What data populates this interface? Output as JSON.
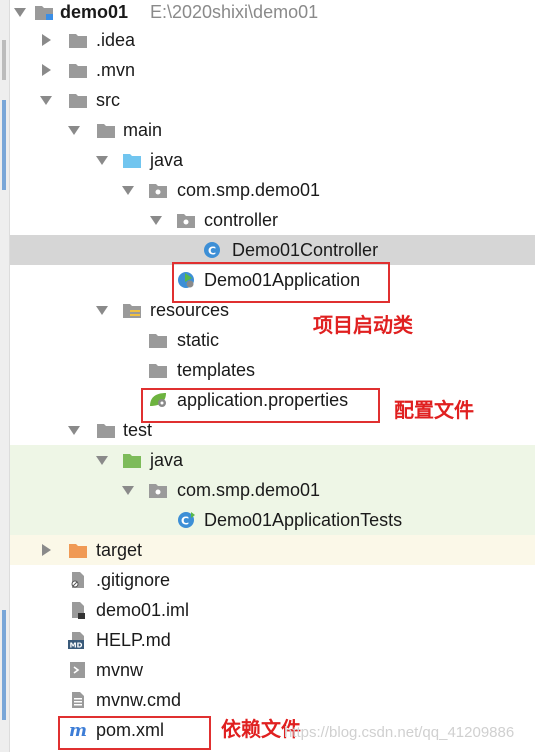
{
  "tree": {
    "root": {
      "label": "demo01",
      "path": "E:\\2020shixi\\demo01"
    },
    "items": [
      {
        "label": ".idea"
      },
      {
        "label": ".mvn"
      },
      {
        "label": "src"
      },
      {
        "label": "main"
      },
      {
        "label": "java"
      },
      {
        "label": "com.smp.demo01"
      },
      {
        "label": "controller"
      },
      {
        "label": "Demo01Controller"
      },
      {
        "label": "Demo01Application"
      },
      {
        "label": "resources"
      },
      {
        "label": "static"
      },
      {
        "label": "templates"
      },
      {
        "label": "application.properties"
      },
      {
        "label": "test"
      },
      {
        "label": "java"
      },
      {
        "label": "com.smp.demo01"
      },
      {
        "label": "Demo01ApplicationTests"
      },
      {
        "label": "target"
      },
      {
        "label": ".gitignore"
      },
      {
        "label": "demo01.iml"
      },
      {
        "label": "HELP.md"
      },
      {
        "label": "mvnw"
      },
      {
        "label": "mvnw.cmd"
      },
      {
        "label": "pom.xml"
      }
    ]
  },
  "annotations": {
    "startup": "项目启动类",
    "config": "配置文件",
    "deps": "依赖文件"
  },
  "watermark": "https://blog.csdn.net/qq_41209886",
  "colors": {
    "annotation": "#e02020",
    "folder": "#9a9a9a",
    "source_folder": "#71c5ef",
    "test_folder": "#7dbb5a",
    "excluded_folder": "#f09a55",
    "selection": "#d6d6d6"
  }
}
